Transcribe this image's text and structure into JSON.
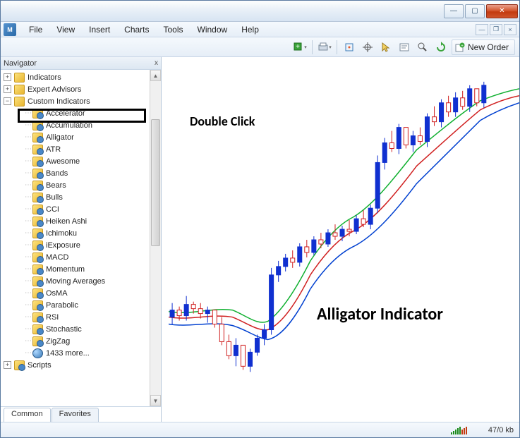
{
  "titlebar": {
    "minimize_glyph": "—",
    "maximize_glyph": "▢",
    "close_glyph": "✕"
  },
  "menu": {
    "app_icon": "M",
    "items": [
      "File",
      "View",
      "Insert",
      "Charts",
      "Tools",
      "Window",
      "Help"
    ]
  },
  "toolbar": {
    "new_order_label": "New Order",
    "icons": [
      "add-chart-icon",
      "print-icon",
      "crosshair-icon",
      "target-icon",
      "cursor-icon",
      "text-icon",
      "zoom-icon",
      "refresh-icon"
    ]
  },
  "navigator": {
    "title": "Navigator",
    "close_glyph": "x",
    "root_items": [
      {
        "label": "Indicators",
        "toggle": "+",
        "icon": "folder"
      },
      {
        "label": "Expert Advisors",
        "toggle": "+",
        "icon": "folder"
      },
      {
        "label": "Custom Indicators",
        "toggle": "−",
        "icon": "folder",
        "expanded": true
      }
    ],
    "custom_indicators": [
      "Accelerator",
      "Accumulation",
      "Alligator",
      "ATR",
      "Awesome",
      "Bands",
      "Bears",
      "Bulls",
      "CCI",
      "Heiken Ashi",
      "Ichimoku",
      "iExposure",
      "MACD",
      "Momentum",
      "Moving Averages",
      "OsMA",
      "Parabolic",
      "RSI",
      "Stochastic",
      "ZigZag"
    ],
    "more_label": "1433 more...",
    "scripts_label": "Scripts",
    "tabs": [
      "Common",
      "Favorites"
    ]
  },
  "annotations": {
    "double_click": "Double Click",
    "indicator_name": "Alligator Indicator"
  },
  "status": {
    "transfer": "47/0 kb"
  },
  "chart_data": {
    "type": "candlestick-with-indicator",
    "description": "Price candlestick chart with Alligator indicator (three smoothed moving averages: jaw=blue, teeth=red, lips=green)",
    "note": "No axes, labels, or numeric values visible; purely illustrative",
    "series": [
      {
        "name": "Jaw",
        "color": "#0040d0"
      },
      {
        "name": "Teeth",
        "color": "#d02020"
      },
      {
        "name": "Lips",
        "color": "#10b030"
      }
    ]
  }
}
